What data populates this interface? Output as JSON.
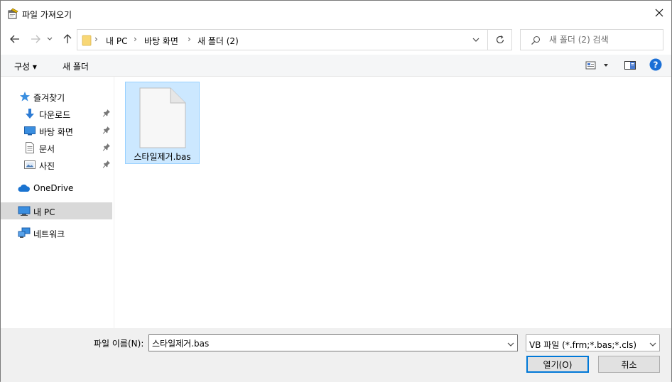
{
  "window": {
    "title": "파일 가져오기"
  },
  "address": {
    "crumbs": [
      "내 PC",
      "바탕 화면",
      "새 폴더 (2)"
    ]
  },
  "search": {
    "placeholder": "새 폴더 (2) 검색"
  },
  "toolbar": {
    "organize_label": "구성 ▾",
    "new_folder_label": "새 폴더"
  },
  "sidebar": {
    "quick_access": "즐겨찾기",
    "items": [
      {
        "label": "다운로드",
        "icon": "download-icon",
        "pinned": true
      },
      {
        "label": "바탕 화면",
        "icon": "desktop-icon",
        "pinned": true
      },
      {
        "label": "문서",
        "icon": "document-icon",
        "pinned": true
      },
      {
        "label": "사진",
        "icon": "picture-icon",
        "pinned": true
      }
    ],
    "onedrive": "OneDrive",
    "this_pc": "내 PC",
    "network": "네트워크",
    "selected": "내 PC"
  },
  "files": [
    {
      "name": "스타일제거.bas",
      "icon": "blank-file-icon",
      "selected": true
    }
  ],
  "footer": {
    "filename_label": "파일 이름(N):",
    "filename_value": "스타일제거.bas",
    "filetype_value": "VB 파일 (*.frm;*.bas;*.cls)",
    "open_label": "열기(O)",
    "cancel_label": "취소"
  },
  "colors": {
    "accent": "#0078d7",
    "selection_bg": "#cce8ff",
    "selection_border": "#99d1ff",
    "help": "#1a6fd6",
    "folder": "#f8d775"
  }
}
